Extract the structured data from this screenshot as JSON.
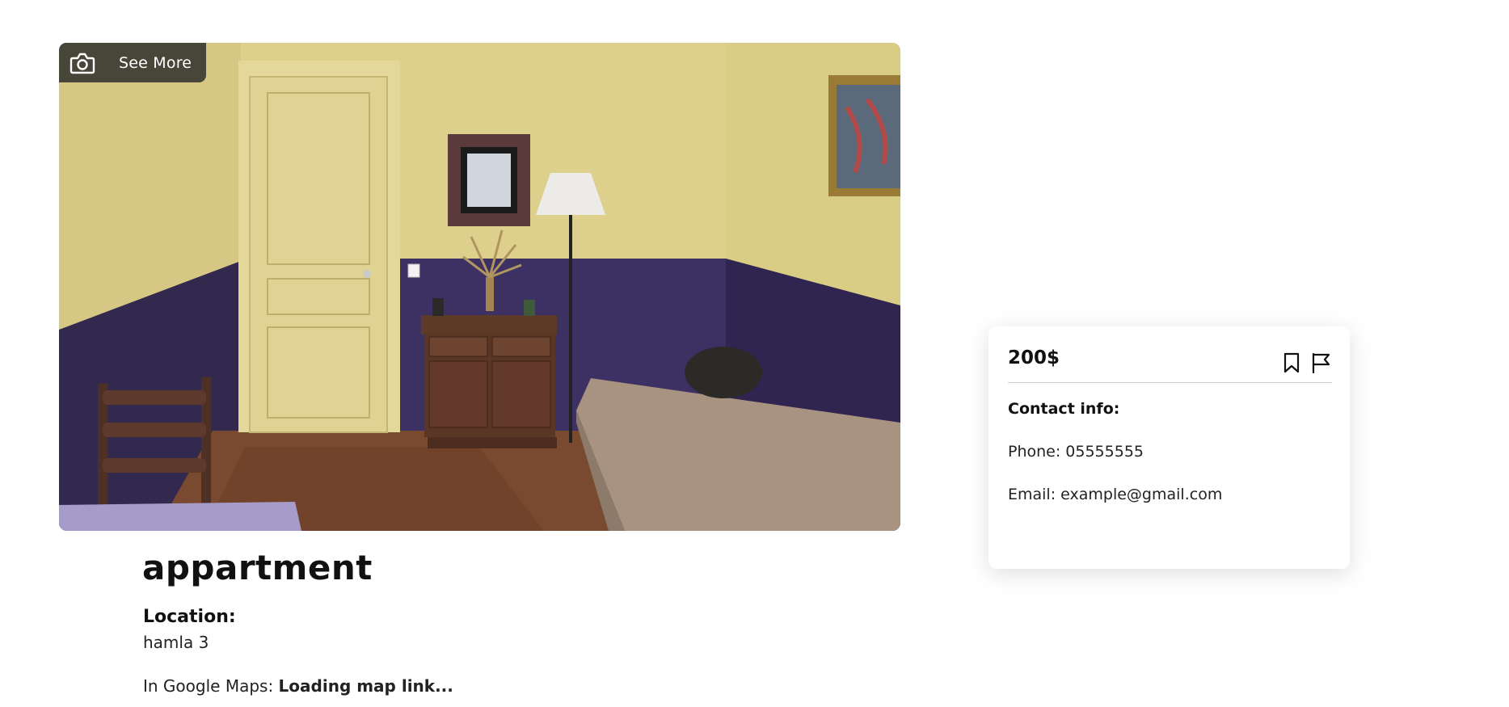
{
  "gallery": {
    "see_more_label": "See More",
    "camera_icon": "camera-icon"
  },
  "listing": {
    "title": "appartment",
    "location_label": "Location:",
    "location_value": "hamla 3",
    "maps_prefix": "In Google Maps:",
    "maps_link_text": "Loading map link..."
  },
  "card": {
    "price": "200$",
    "bookmark_icon": "bookmark-icon",
    "flag_icon": "flag-icon",
    "contact_label": "Contact info:",
    "phone": "Phone: 05555555",
    "email": "Email: example@gmail.com"
  },
  "colors": {
    "wall_upper": "#ddd08c",
    "wall_lower": "#3b2f5e",
    "floor": "#7a4a30",
    "overlay_bg": "#282828"
  }
}
